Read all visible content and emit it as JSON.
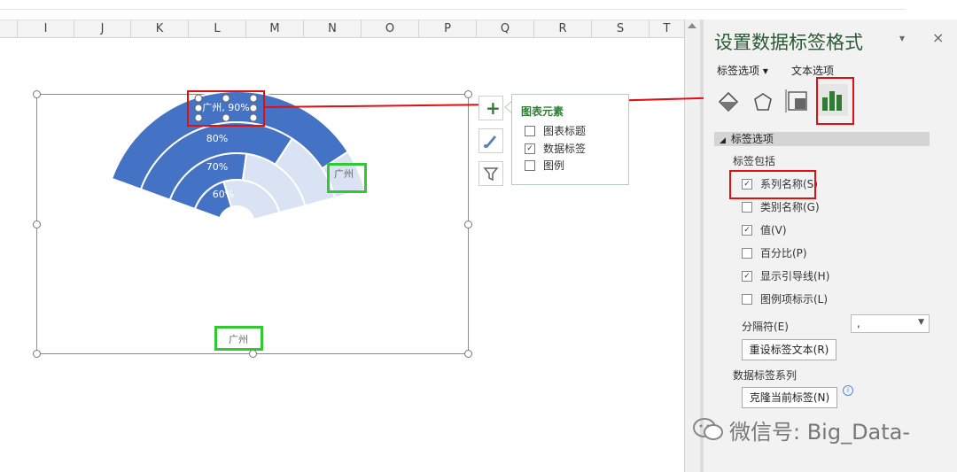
{
  "columns": [
    "I",
    "J",
    "K",
    "L",
    "M",
    "N",
    "O",
    "P",
    "Q",
    "R",
    "S",
    "T"
  ],
  "chart": {
    "labels": {
      "outer": "广州, 90%",
      "ring2": "80%",
      "ring3": "70%",
      "ring4": "60%",
      "side": "广州",
      "legend": "广州"
    },
    "colors": {
      "main": "#4472c4",
      "light": "#dae3f3"
    }
  },
  "chart_buttons": {
    "add": "+",
    "style": "brush-icon",
    "filter": "funnel-icon"
  },
  "chart_elements_panel": {
    "title": "图表元素",
    "items": [
      {
        "label": "图表标题",
        "checked": false
      },
      {
        "label": "数据标签",
        "checked": true
      },
      {
        "label": "图例",
        "checked": false
      }
    ]
  },
  "pane": {
    "title": "设置数据标签格式",
    "menu": "▾",
    "close": "×",
    "tabs": {
      "label_options": "标签选项 ▾",
      "text_options": "文本选项"
    },
    "section": "标签选项",
    "includes_label": "标签包括",
    "options": [
      {
        "label": "系列名称(S)",
        "checked": true
      },
      {
        "label": "类别名称(G)",
        "checked": false
      },
      {
        "label": "值(V)",
        "checked": true
      },
      {
        "label": "百分比(P)",
        "checked": false
      },
      {
        "label": "显示引导线(H)",
        "checked": true
      },
      {
        "label": "图例项标示(L)",
        "checked": false
      }
    ],
    "separator_label": "分隔符(E)",
    "separator_value": ",",
    "reset_button": "重设标签文本(R)",
    "series_label": "数据标签系列",
    "clone_button": "克隆当前标签(N)",
    "info": "i"
  },
  "watermark": "微信号: Big_Data-"
}
